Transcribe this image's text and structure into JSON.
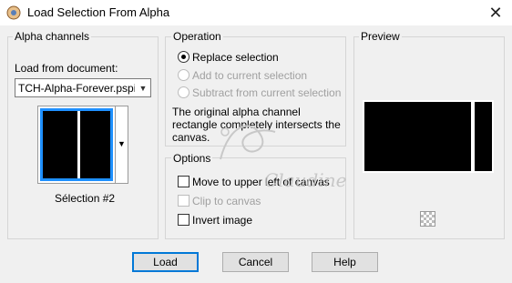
{
  "window": {
    "title": "Load Selection From Alpha",
    "close_glyph": "✕"
  },
  "alpha_channels": {
    "group_label": "Alpha channels",
    "load_from_label": "Load from document:",
    "document_value": "TCH-Alpha-Forever.pspimage",
    "selection_name": "Sélection #2"
  },
  "operation": {
    "group_label": "Operation",
    "options": [
      {
        "label": "Replace selection",
        "checked": true,
        "enabled": true
      },
      {
        "label": "Add to current selection",
        "checked": false,
        "enabled": false
      },
      {
        "label": "Subtract from current selection",
        "checked": false,
        "enabled": false
      }
    ],
    "message": "The original alpha channel rectangle completely intersects the canvas."
  },
  "options": {
    "group_label": "Options",
    "items": [
      {
        "label": "Move to upper left of canvas",
        "checked": false,
        "enabled": true
      },
      {
        "label": "Clip to canvas",
        "checked": false,
        "enabled": false
      },
      {
        "label": "Invert image",
        "checked": false,
        "enabled": true
      }
    ]
  },
  "preview": {
    "group_label": "Preview"
  },
  "buttons": {
    "load": "Load",
    "cancel": "Cancel",
    "help": "Help"
  },
  "watermark": "Claudine",
  "colors": {
    "selection_border": "#1e90ff",
    "default_button_border": "#0078d7"
  }
}
